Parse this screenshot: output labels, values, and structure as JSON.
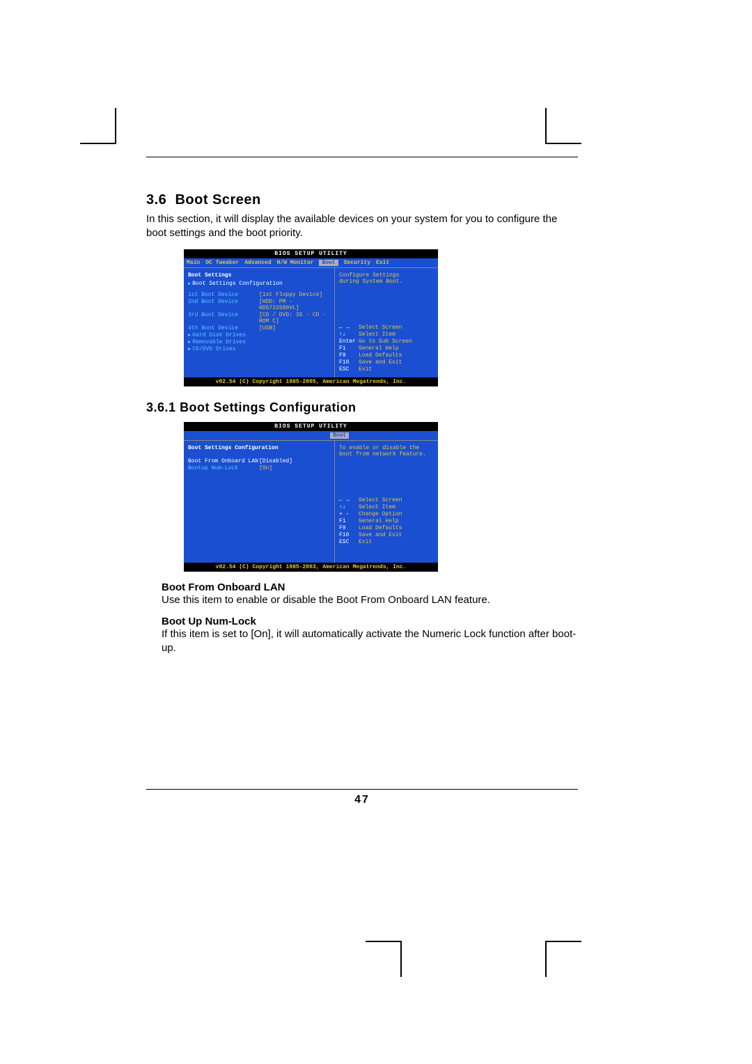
{
  "page_number": "47",
  "section": {
    "number": "3.6",
    "title": "Boot Screen"
  },
  "intro": "In this section, it will display the available devices on your system for you to configure the boot settings and the boot priority.",
  "subsection": {
    "number": "3.6.1",
    "title": "Boot Settings Configuration"
  },
  "items": {
    "onboard_lan": {
      "title": "Boot From Onboard LAN",
      "text": "Use this item to enable or disable the Boot From Onboard LAN feature."
    },
    "numlock": {
      "title": "Boot Up Num-Lock",
      "text": "If this item is set to [On], it will automatically activate the Numeric Lock function after boot-up."
    }
  },
  "bios1": {
    "title": "BIOS SETUP UTILITY",
    "tabs": [
      "Main",
      "OC Tweaker",
      "Advanced",
      "H/W Monitor",
      "Boot",
      "Security",
      "Exit"
    ],
    "active_tab": "Boot",
    "section_header": "Boot Settings",
    "subsection": "Boot Settings Configuration",
    "devices": [
      {
        "label": "1st Boot Device",
        "value": "[1st  Floppy Device]"
      },
      {
        "label": "2nd Boot Device",
        "value": "[HDD: PM - HDS722580VL]"
      },
      {
        "label": "3rd Boot Device",
        "value": "[CD / DVD: 3S - CD - ROM C]"
      },
      {
        "label": "4th Boot Device",
        "value": "[USB]"
      }
    ],
    "drive_groups": [
      "Hard Disk Drives",
      "Removable Drives",
      "CD/DVD Drives"
    ],
    "help": [
      "Configure Settings",
      "during System Boot."
    ],
    "keys": [
      {
        "k": "← →",
        "d": "Select Screen"
      },
      {
        "k": "↑↓",
        "d": "Select Item"
      },
      {
        "k": "Enter",
        "d": "Go to Sub Screen"
      },
      {
        "k": "F1",
        "d": "General Help"
      },
      {
        "k": "F9",
        "d": "Load Defaults"
      },
      {
        "k": "F10",
        "d": "Save and Exit"
      },
      {
        "k": "ESC",
        "d": "Exit"
      }
    ],
    "footer": "v02.54 (C) Copyright 1985-2005, American Megatrends, Inc."
  },
  "bios2": {
    "title": "BIOS SETUP UTILITY",
    "active_tab": "Boot",
    "section_header": "Boot Settings Configuration",
    "rows": [
      {
        "label": "Boot From Onboard LAN",
        "value": "[Disabled]",
        "sel": true
      },
      {
        "label": "Bootup Num-Lock",
        "value": "[On]",
        "sel": false
      }
    ],
    "help": [
      "To enable or disable the",
      "boot from network feature."
    ],
    "keys": [
      {
        "k": "← →",
        "d": "Select Screen"
      },
      {
        "k": "↑↓",
        "d": "Select Item"
      },
      {
        "k": "+ -",
        "d": "Change Option"
      },
      {
        "k": "F1",
        "d": "General Help"
      },
      {
        "k": "F9",
        "d": "Load Defaults"
      },
      {
        "k": "F10",
        "d": "Save and Exit"
      },
      {
        "k": "ESC",
        "d": "Exit"
      }
    ],
    "footer": "v02.54 (C) Copyright 1985-2003, American Megatrends, Inc."
  }
}
